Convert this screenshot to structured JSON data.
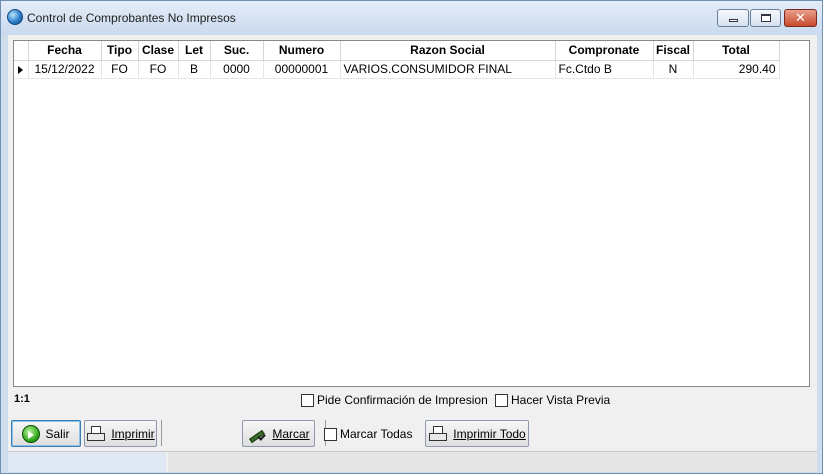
{
  "window": {
    "title": "Control de Comprobantes No Impresos",
    "icon": "app-globe-icon",
    "controls": {
      "minimize": "minimize-icon",
      "maximize": "maximize-icon",
      "close": "close-icon",
      "close_glyph": "✕"
    }
  },
  "grid": {
    "columns": [
      "Fecha",
      "Tipo",
      "Clase",
      "Let",
      "Suc.",
      "Numero",
      "Razon Social",
      "Compronate",
      "Fiscal",
      "Total"
    ],
    "rows": [
      {
        "Fecha": "15/12/2022",
        "Tipo": "FO",
        "Clase": "FO",
        "Let": "B",
        "Suc": "0000",
        "Numero": "00000001",
        "RazonSocial": "VARIOS.CONSUMIDOR FINAL",
        "Compronate": "Fc.Ctdo B",
        "Fiscal": "N",
        "Total": "290.40"
      }
    ]
  },
  "record_count": "1:1",
  "options": {
    "pide_confirmacion": {
      "label": "Pide Confirmación de Impresion",
      "checked": false
    },
    "vista_previa": {
      "label": "Hacer Vista Previa",
      "checked": false
    }
  },
  "toolbar": {
    "salir": "Salir",
    "imprimir": "Imprimir",
    "marcar": "Marcar",
    "marcar_todas": {
      "label": "Marcar Todas",
      "checked": false
    },
    "imprimir_todo": "Imprimir Todo"
  },
  "colors": {
    "accent": "#3c7fb1",
    "titlebar": "#c9d9ee",
    "close": "#c8482c"
  }
}
